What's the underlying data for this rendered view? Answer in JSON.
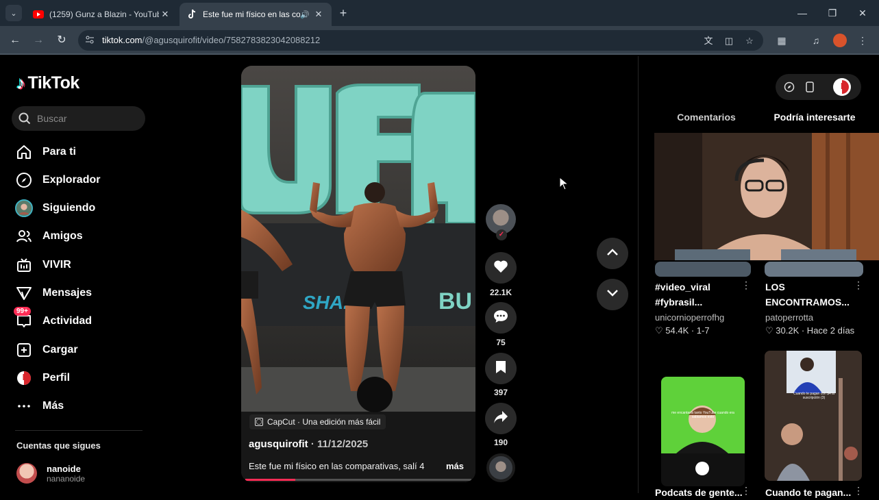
{
  "browser": {
    "tabs": [
      {
        "title": "(1259) Gunz a Blazin - YouTube",
        "favicon": "youtube-icon",
        "active": false
      },
      {
        "title": "Este fue mi físico en las comparativas",
        "favicon": "tiktok-icon",
        "active": true
      }
    ],
    "url_host": "tiktok.com",
    "url_path": "/@agusquirofit/video/7582783823042088212"
  },
  "sidebar": {
    "logo_text": "TikTok",
    "search_placeholder": "Buscar",
    "items": [
      {
        "label": "Para ti",
        "icon": "home-icon"
      },
      {
        "label": "Explorador",
        "icon": "compass-icon"
      },
      {
        "label": "Siguiendo",
        "icon": "following-avatar-icon"
      },
      {
        "label": "Amigos",
        "icon": "friends-icon"
      },
      {
        "label": "VIVIR",
        "icon": "live-icon"
      },
      {
        "label": "Mensajes",
        "icon": "messages-icon"
      },
      {
        "label": "Actividad",
        "icon": "activity-icon",
        "badge": "99+"
      },
      {
        "label": "Cargar",
        "icon": "upload-icon"
      },
      {
        "label": "Perfil",
        "icon": "profile-icon"
      },
      {
        "label": "Más",
        "icon": "more-icon"
      }
    ],
    "following_title": "Cuentas que sigues",
    "accounts": [
      {
        "name": "nanoide",
        "handle": "nananoide"
      }
    ]
  },
  "video": {
    "capcut_label": "CapCut · Una edición más fácil",
    "username": "agusquirofit",
    "date": " · 11/12/2025",
    "description": "Este fue mi físico en las comparativas, salí 4",
    "more_label": "más",
    "progress": 0.22
  },
  "actions": {
    "likes": "22.1K",
    "comments": "75",
    "saves": "397",
    "shares": "190"
  },
  "right_panel": {
    "tabs": [
      "Comentarios",
      "Podría interesarte"
    ],
    "active_tab": "Podría interesarte",
    "cards": [
      {
        "title_line1": "#video_viral",
        "title_line2": "#fybrasil...",
        "author": "unicorniоperrofhg",
        "stats": "54.4K · 1-7"
      },
      {
        "title_line1": "LOS",
        "title_line2": "ENCONTRAMOS...",
        "author": "patoperrotta",
        "stats": "30.2K · Hace 2 días"
      },
      {
        "title_line1": "Podcats de gente..."
      },
      {
        "title_line1": "Cuando te pagan..."
      }
    ],
    "thumb_texts": {
      "green_caption": "me encantaría tanto YouTube cuando era sabiamos esto",
      "pay_caption": "Cuando te pagan con $4 la suscripción (3)"
    }
  },
  "colors": {
    "accent": "#fe2c55",
    "tiktok_cyan": "#25f4ee",
    "background": "#000000",
    "chrome_dark": "#1f2a35"
  }
}
